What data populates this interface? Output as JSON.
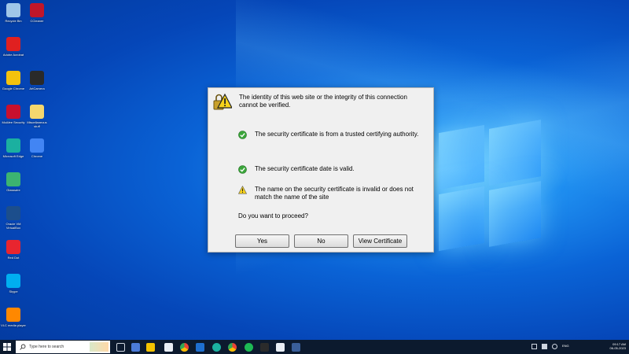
{
  "dialog": {
    "heading": "The identity of this web site or the integrity of this connection cannot be verified.",
    "checks": [
      {
        "status": "ok",
        "icon": "green-check-icon",
        "text": "The security certificate is from a trusted certifying authority."
      },
      {
        "status": "ok",
        "icon": "green-check-icon",
        "text": "The security certificate date is valid."
      },
      {
        "status": "warning",
        "icon": "warning-icon",
        "text": "The name on the security certificate is invalid or does not match the name of the site"
      }
    ],
    "question": "Do you want to proceed?",
    "buttons": {
      "yes": "Yes",
      "no": "No",
      "view": "View Certificate"
    }
  },
  "desktop_icons": [
    {
      "label": "Recycle Bin",
      "icon": "recycle-bin-icon",
      "color": "#9fc6e8"
    },
    {
      "label": "CCleaner",
      "icon": "app-icon",
      "color": "#c0162a"
    },
    {
      "label": "Adobe Acrobat",
      "icon": "acrobat-icon",
      "color": "#e02020"
    },
    {
      "label": "Google Chrome",
      "icon": "chrome-icon",
      "color": "#f4c20d"
    },
    {
      "label": "ArtCamera",
      "icon": "app-icon",
      "color": "#2a2a2a"
    },
    {
      "label": "McAfee Security",
      "icon": "mcafee-icon",
      "color": "#c8102e"
    },
    {
      "label": "Miscellaneous stuff",
      "icon": "folder-icon",
      "color": "#f5d76e"
    },
    {
      "label": "Microsoft Edge",
      "icon": "edge-icon",
      "color": "#1bb0a0"
    },
    {
      "label": "Chrome",
      "icon": "chrome-icon",
      "color": "#4285f4"
    },
    {
      "label": "Glasswire",
      "icon": "app-icon",
      "color": "#3cb371"
    },
    {
      "label": "Oracle VM VirtualBox",
      "icon": "virtualbox-icon",
      "color": "#1c4e8c"
    },
    {
      "label": "Red Dot",
      "icon": "app-icon",
      "color": "#e8252f"
    },
    {
      "label": "Skype",
      "icon": "skype-icon",
      "color": "#00aff0"
    },
    {
      "label": "VLC media player",
      "icon": "vlc-icon",
      "color": "#ff8800"
    }
  ],
  "taskbar": {
    "search_placeholder": "Type here to search",
    "tray_time": "09:17 AM",
    "tray_date": "06-05-2023",
    "tray_lang": "ENG"
  },
  "colors": {
    "ok": "#2e9b2e",
    "warning": "#f3c200",
    "desktop": "#0a63d6",
    "taskbar": "#0c1a2e"
  }
}
